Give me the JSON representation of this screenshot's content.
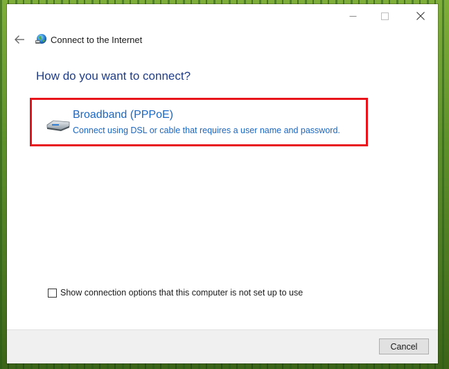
{
  "window": {
    "title": "Connect to the Internet",
    "controls": {
      "minimize_icon": "minimize-icon",
      "maximize_icon": "maximize-icon",
      "close_icon": "close-icon"
    }
  },
  "nav": {
    "back_icon": "back-arrow-icon",
    "app_icon": "globe-network-icon"
  },
  "main": {
    "heading": "How do you want to connect?",
    "options": [
      {
        "icon": "broadband-modem-icon",
        "title": "Broadband (PPPoE)",
        "description": "Connect using DSL or cable that requires a user name and password.",
        "highlight_color": "#e8121b"
      }
    ],
    "show_options_checkbox": {
      "label": "Show connection options that this computer is not set up to use",
      "checked": false
    }
  },
  "footer": {
    "cancel_label": "Cancel"
  },
  "colors": {
    "heading": "#1f3c88",
    "link": "#1a66c2",
    "highlight": "#e8121b"
  }
}
